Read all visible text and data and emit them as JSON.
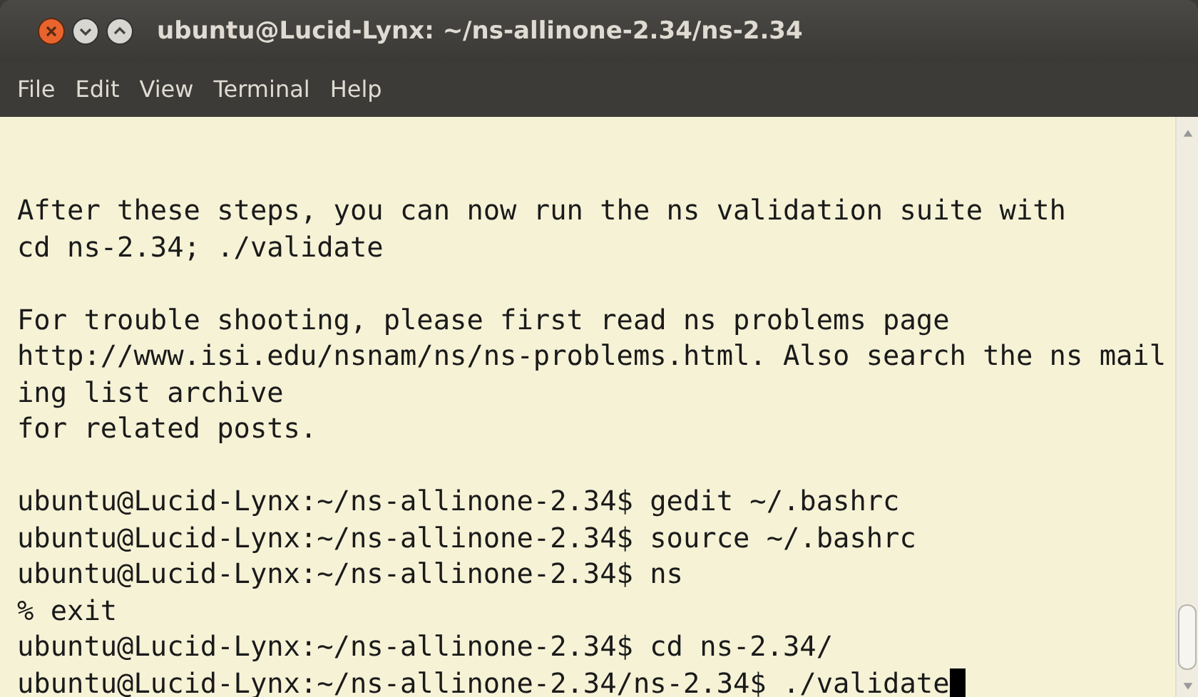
{
  "window": {
    "title": "ubuntu@Lucid-Lynx: ~/ns-allinone-2.34/ns-2.34"
  },
  "menu": [
    "File",
    "Edit",
    "View",
    "Terminal",
    "Help"
  ],
  "terminal": {
    "blocks": [
      [
        "After these steps, you can now run the ns validation suite with",
        "cd ns-2.34; ./validate"
      ],
      [
        "For trouble shooting, please first read ns problems page",
        "http://www.isi.edu/nsnam/ns/ns-problems.html. Also search the ns mail",
        "ing list archive",
        "for related posts."
      ],
      [
        "ubuntu@Lucid-Lynx:~/ns-allinone-2.34$ gedit ~/.bashrc",
        "ubuntu@Lucid-Lynx:~/ns-allinone-2.34$ source ~/.bashrc",
        "ubuntu@Lucid-Lynx:~/ns-allinone-2.34$ ns",
        "% exit",
        "ubuntu@Lucid-Lynx:~/ns-allinone-2.34$ cd ns-2.34/",
        "ubuntu@Lucid-Lynx:~/ns-allinone-2.34/ns-2.34$ ./validate"
      ]
    ],
    "cursor": true
  }
}
